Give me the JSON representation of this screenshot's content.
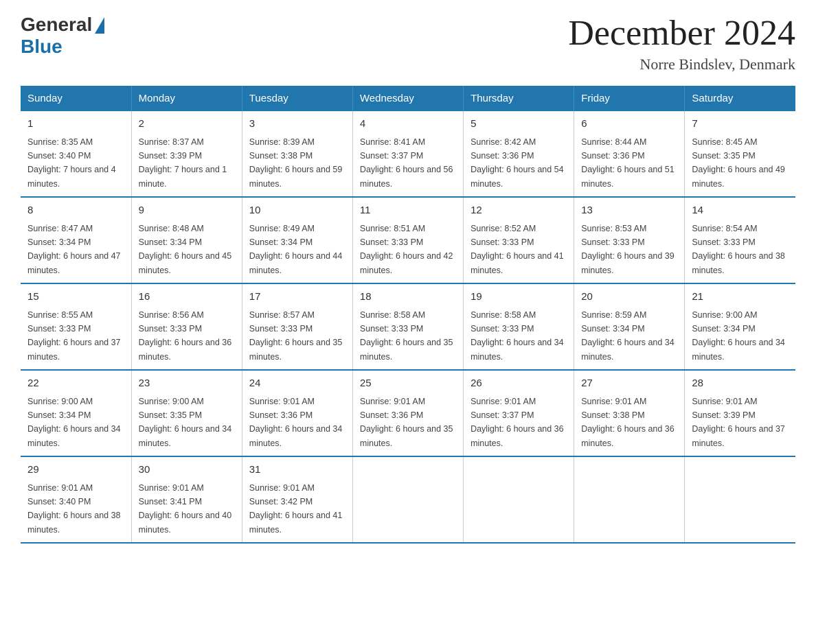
{
  "logo": {
    "general": "General",
    "blue": "Blue"
  },
  "title": {
    "month": "December 2024",
    "location": "Norre Bindslev, Denmark"
  },
  "weekdays": [
    "Sunday",
    "Monday",
    "Tuesday",
    "Wednesday",
    "Thursday",
    "Friday",
    "Saturday"
  ],
  "weeks": [
    [
      {
        "day": "1",
        "sunrise": "8:35 AM",
        "sunset": "3:40 PM",
        "daylight": "7 hours and 4 minutes."
      },
      {
        "day": "2",
        "sunrise": "8:37 AM",
        "sunset": "3:39 PM",
        "daylight": "7 hours and 1 minute."
      },
      {
        "day": "3",
        "sunrise": "8:39 AM",
        "sunset": "3:38 PM",
        "daylight": "6 hours and 59 minutes."
      },
      {
        "day": "4",
        "sunrise": "8:41 AM",
        "sunset": "3:37 PM",
        "daylight": "6 hours and 56 minutes."
      },
      {
        "day": "5",
        "sunrise": "8:42 AM",
        "sunset": "3:36 PM",
        "daylight": "6 hours and 54 minutes."
      },
      {
        "day": "6",
        "sunrise": "8:44 AM",
        "sunset": "3:36 PM",
        "daylight": "6 hours and 51 minutes."
      },
      {
        "day": "7",
        "sunrise": "8:45 AM",
        "sunset": "3:35 PM",
        "daylight": "6 hours and 49 minutes."
      }
    ],
    [
      {
        "day": "8",
        "sunrise": "8:47 AM",
        "sunset": "3:34 PM",
        "daylight": "6 hours and 47 minutes."
      },
      {
        "day": "9",
        "sunrise": "8:48 AM",
        "sunset": "3:34 PM",
        "daylight": "6 hours and 45 minutes."
      },
      {
        "day": "10",
        "sunrise": "8:49 AM",
        "sunset": "3:34 PM",
        "daylight": "6 hours and 44 minutes."
      },
      {
        "day": "11",
        "sunrise": "8:51 AM",
        "sunset": "3:33 PM",
        "daylight": "6 hours and 42 minutes."
      },
      {
        "day": "12",
        "sunrise": "8:52 AM",
        "sunset": "3:33 PM",
        "daylight": "6 hours and 41 minutes."
      },
      {
        "day": "13",
        "sunrise": "8:53 AM",
        "sunset": "3:33 PM",
        "daylight": "6 hours and 39 minutes."
      },
      {
        "day": "14",
        "sunrise": "8:54 AM",
        "sunset": "3:33 PM",
        "daylight": "6 hours and 38 minutes."
      }
    ],
    [
      {
        "day": "15",
        "sunrise": "8:55 AM",
        "sunset": "3:33 PM",
        "daylight": "6 hours and 37 minutes."
      },
      {
        "day": "16",
        "sunrise": "8:56 AM",
        "sunset": "3:33 PM",
        "daylight": "6 hours and 36 minutes."
      },
      {
        "day": "17",
        "sunrise": "8:57 AM",
        "sunset": "3:33 PM",
        "daylight": "6 hours and 35 minutes."
      },
      {
        "day": "18",
        "sunrise": "8:58 AM",
        "sunset": "3:33 PM",
        "daylight": "6 hours and 35 minutes."
      },
      {
        "day": "19",
        "sunrise": "8:58 AM",
        "sunset": "3:33 PM",
        "daylight": "6 hours and 34 minutes."
      },
      {
        "day": "20",
        "sunrise": "8:59 AM",
        "sunset": "3:34 PM",
        "daylight": "6 hours and 34 minutes."
      },
      {
        "day": "21",
        "sunrise": "9:00 AM",
        "sunset": "3:34 PM",
        "daylight": "6 hours and 34 minutes."
      }
    ],
    [
      {
        "day": "22",
        "sunrise": "9:00 AM",
        "sunset": "3:34 PM",
        "daylight": "6 hours and 34 minutes."
      },
      {
        "day": "23",
        "sunrise": "9:00 AM",
        "sunset": "3:35 PM",
        "daylight": "6 hours and 34 minutes."
      },
      {
        "day": "24",
        "sunrise": "9:01 AM",
        "sunset": "3:36 PM",
        "daylight": "6 hours and 34 minutes."
      },
      {
        "day": "25",
        "sunrise": "9:01 AM",
        "sunset": "3:36 PM",
        "daylight": "6 hours and 35 minutes."
      },
      {
        "day": "26",
        "sunrise": "9:01 AM",
        "sunset": "3:37 PM",
        "daylight": "6 hours and 36 minutes."
      },
      {
        "day": "27",
        "sunrise": "9:01 AM",
        "sunset": "3:38 PM",
        "daylight": "6 hours and 36 minutes."
      },
      {
        "day": "28",
        "sunrise": "9:01 AM",
        "sunset": "3:39 PM",
        "daylight": "6 hours and 37 minutes."
      }
    ],
    [
      {
        "day": "29",
        "sunrise": "9:01 AM",
        "sunset": "3:40 PM",
        "daylight": "6 hours and 38 minutes."
      },
      {
        "day": "30",
        "sunrise": "9:01 AM",
        "sunset": "3:41 PM",
        "daylight": "6 hours and 40 minutes."
      },
      {
        "day": "31",
        "sunrise": "9:01 AM",
        "sunset": "3:42 PM",
        "daylight": "6 hours and 41 minutes."
      },
      null,
      null,
      null,
      null
    ]
  ]
}
